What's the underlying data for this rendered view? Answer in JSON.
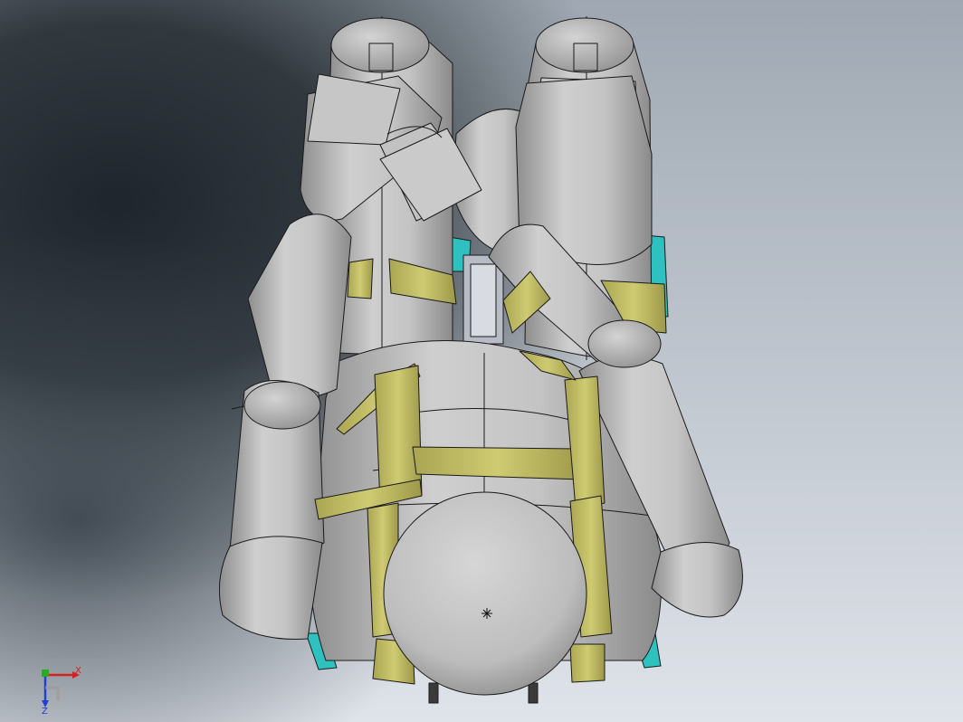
{
  "view": {
    "background_dark": "#1f252c",
    "background_mid": "#5c6670",
    "background_light": "#dfe3ea"
  },
  "model": {
    "body_color": "#c9c9c9",
    "body_shade": "#8e8e8e",
    "strap_color": "#c8c46a",
    "strap_shade": "#8f8a3a",
    "seat_color": "#2fc1bf",
    "line_color": "#1a1a1a"
  },
  "triad": {
    "x_label": "X",
    "z_label": "Z",
    "x_color": "#d32020",
    "y_color": "#20b020",
    "z_color": "#2040d0"
  }
}
